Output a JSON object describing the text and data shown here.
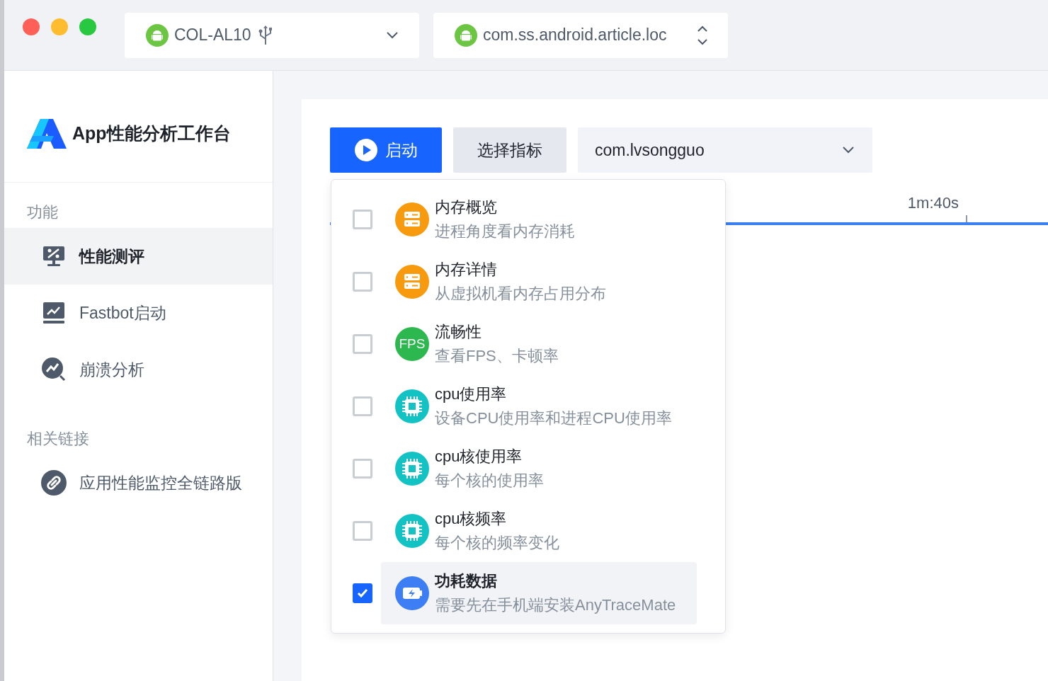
{
  "toolbar": {
    "device": {
      "name": "COL-AL10"
    },
    "package": {
      "value": "com.ss.android.article.loc"
    }
  },
  "sidebar": {
    "app_title": "App性能分析工作台",
    "sections": [
      {
        "heading": "功能",
        "items": [
          {
            "label": "性能测评",
            "kind": "monitor",
            "selected": true
          },
          {
            "label": "Fastbot启动",
            "kind": "chart",
            "selected": false
          },
          {
            "label": "崩溃分析",
            "kind": "search-chart",
            "selected": false
          }
        ]
      },
      {
        "heading": "相关链接",
        "items": [
          {
            "label": "应用性能监控全链路版",
            "kind": "link",
            "selected": false
          }
        ]
      }
    ]
  },
  "main": {
    "start_button": "启动",
    "metrics_button": "选择指标",
    "app_select": {
      "value": "com.lvsongguo"
    },
    "timeline": {
      "label": "1m:40s"
    },
    "metrics_dropdown": [
      {
        "kind": "memory",
        "title": "内存概览",
        "description": "进程角度看内存消耗",
        "checked": false,
        "selected": false
      },
      {
        "kind": "memory",
        "title": "内存详情",
        "description": "从虚拟机看内存占用分布",
        "checked": false,
        "selected": false
      },
      {
        "kind": "fps",
        "title": "流畅性",
        "description": "查看FPS、卡顿率",
        "icon_text": "FPS",
        "checked": false,
        "selected": false
      },
      {
        "kind": "cpu",
        "title": "cpu使用率",
        "description": "设备CPU使用率和进程CPU使用率",
        "checked": false,
        "selected": false
      },
      {
        "kind": "cpu",
        "title": "cpu核使用率",
        "description": "每个核的使用率",
        "checked": false,
        "selected": false
      },
      {
        "kind": "cpu",
        "title": "cpu核频率",
        "description": "每个核的频率变化",
        "checked": false,
        "selected": false
      },
      {
        "kind": "power",
        "title": "功耗数据",
        "description": "需要先在手机端安装AnyTraceMate",
        "checked": true,
        "selected": true
      }
    ]
  }
}
